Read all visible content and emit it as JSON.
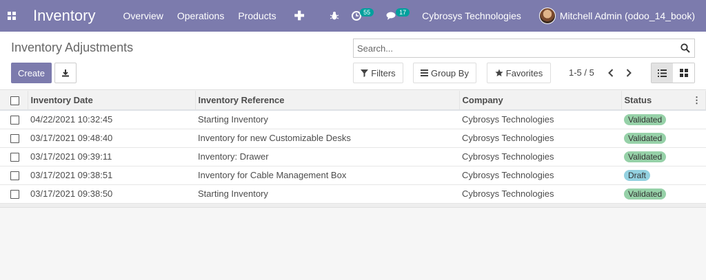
{
  "navbar": {
    "app_name": "Inventory",
    "menu": [
      "Overview",
      "Operations",
      "Products"
    ],
    "activity_count": "55",
    "message_count": "17",
    "company": "Cybrosys Technologies",
    "user": "Mitchell Admin (odoo_14_book)",
    "accent_color": "#7c7bad",
    "badge_color": "#00a09d"
  },
  "control_panel": {
    "title": "Inventory Adjustments",
    "search_placeholder": "Search...",
    "create_label": "Create",
    "filters_label": "Filters",
    "group_by_label": "Group By",
    "favorites_label": "Favorites",
    "pager": "1-5 / 5"
  },
  "table": {
    "columns": [
      "Inventory Date",
      "Inventory Reference",
      "Company",
      "Status"
    ],
    "rows": [
      {
        "date": "04/22/2021 10:32:45",
        "reference": "Starting Inventory",
        "company": "Cybrosys Technologies",
        "status": "Validated"
      },
      {
        "date": "03/17/2021 09:48:40",
        "reference": "Inventory for new Customizable Desks",
        "company": "Cybrosys Technologies",
        "status": "Validated"
      },
      {
        "date": "03/17/2021 09:39:11",
        "reference": "Inventory: Drawer",
        "company": "Cybrosys Technologies",
        "status": "Validated"
      },
      {
        "date": "03/17/2021 09:38:51",
        "reference": "Inventory for Cable Management Box",
        "company": "Cybrosys Technologies",
        "status": "Draft"
      },
      {
        "date": "03/17/2021 09:38:50",
        "reference": "Starting Inventory",
        "company": "Cybrosys Technologies",
        "status": "Validated"
      }
    ]
  }
}
